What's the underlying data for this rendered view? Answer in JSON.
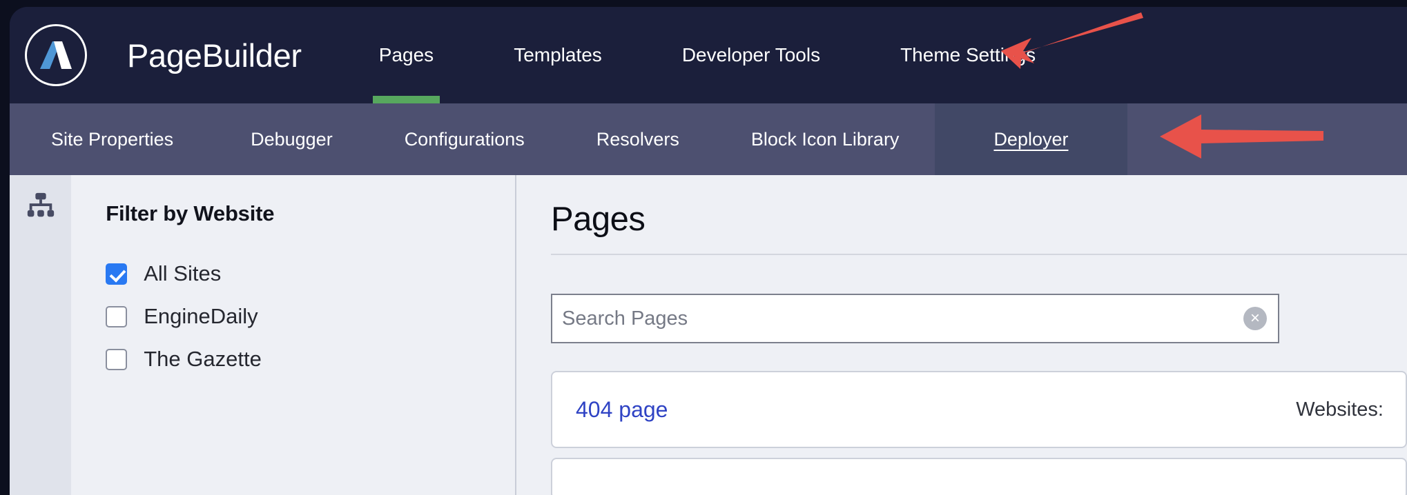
{
  "colors": {
    "header_bg": "#1b1f3b",
    "subnav_bg": "#4d5070",
    "subnav_active_bg": "#414866",
    "accent_green": "#57a85e",
    "accent_blue": "#2979f2",
    "link_blue": "#2f43c4",
    "annotation_red": "#e8524a",
    "panel_bg": "#eef0f5",
    "rail_bg": "#e0e3eb"
  },
  "header": {
    "brand": "PageBuilder",
    "logo_icon": "pagebuilder-logo-icon",
    "nav": [
      {
        "label": "Pages",
        "active": true
      },
      {
        "label": "Templates",
        "active": false
      },
      {
        "label": "Developer Tools",
        "active": false
      },
      {
        "label": "Theme Settings",
        "active": false
      }
    ]
  },
  "subnav": {
    "items": [
      {
        "label": "Site Properties",
        "active": false
      },
      {
        "label": "Debugger",
        "active": false
      },
      {
        "label": "Configurations",
        "active": false
      },
      {
        "label": "Resolvers",
        "active": false
      },
      {
        "label": "Block Icon Library",
        "active": false
      },
      {
        "label": "Deployer",
        "active": true
      }
    ]
  },
  "rail": {
    "icons": [
      {
        "name": "sitemap-icon"
      }
    ]
  },
  "filter": {
    "title": "Filter by Website",
    "options": [
      {
        "label": "All Sites",
        "checked": true
      },
      {
        "label": "EngineDaily",
        "checked": false
      },
      {
        "label": "The Gazette",
        "checked": false
      }
    ]
  },
  "main": {
    "title": "Pages",
    "search": {
      "placeholder": "Search Pages",
      "value": "",
      "clear_glyph": "×",
      "clear_icon": "clear-search-icon"
    },
    "results": [
      {
        "title": "404 page",
        "meta_label": "Websites:"
      }
    ]
  },
  "annotations": [
    {
      "name": "arrow-developer-tools",
      "target": "Developer Tools"
    },
    {
      "name": "arrow-deployer",
      "target": "Deployer"
    }
  ]
}
